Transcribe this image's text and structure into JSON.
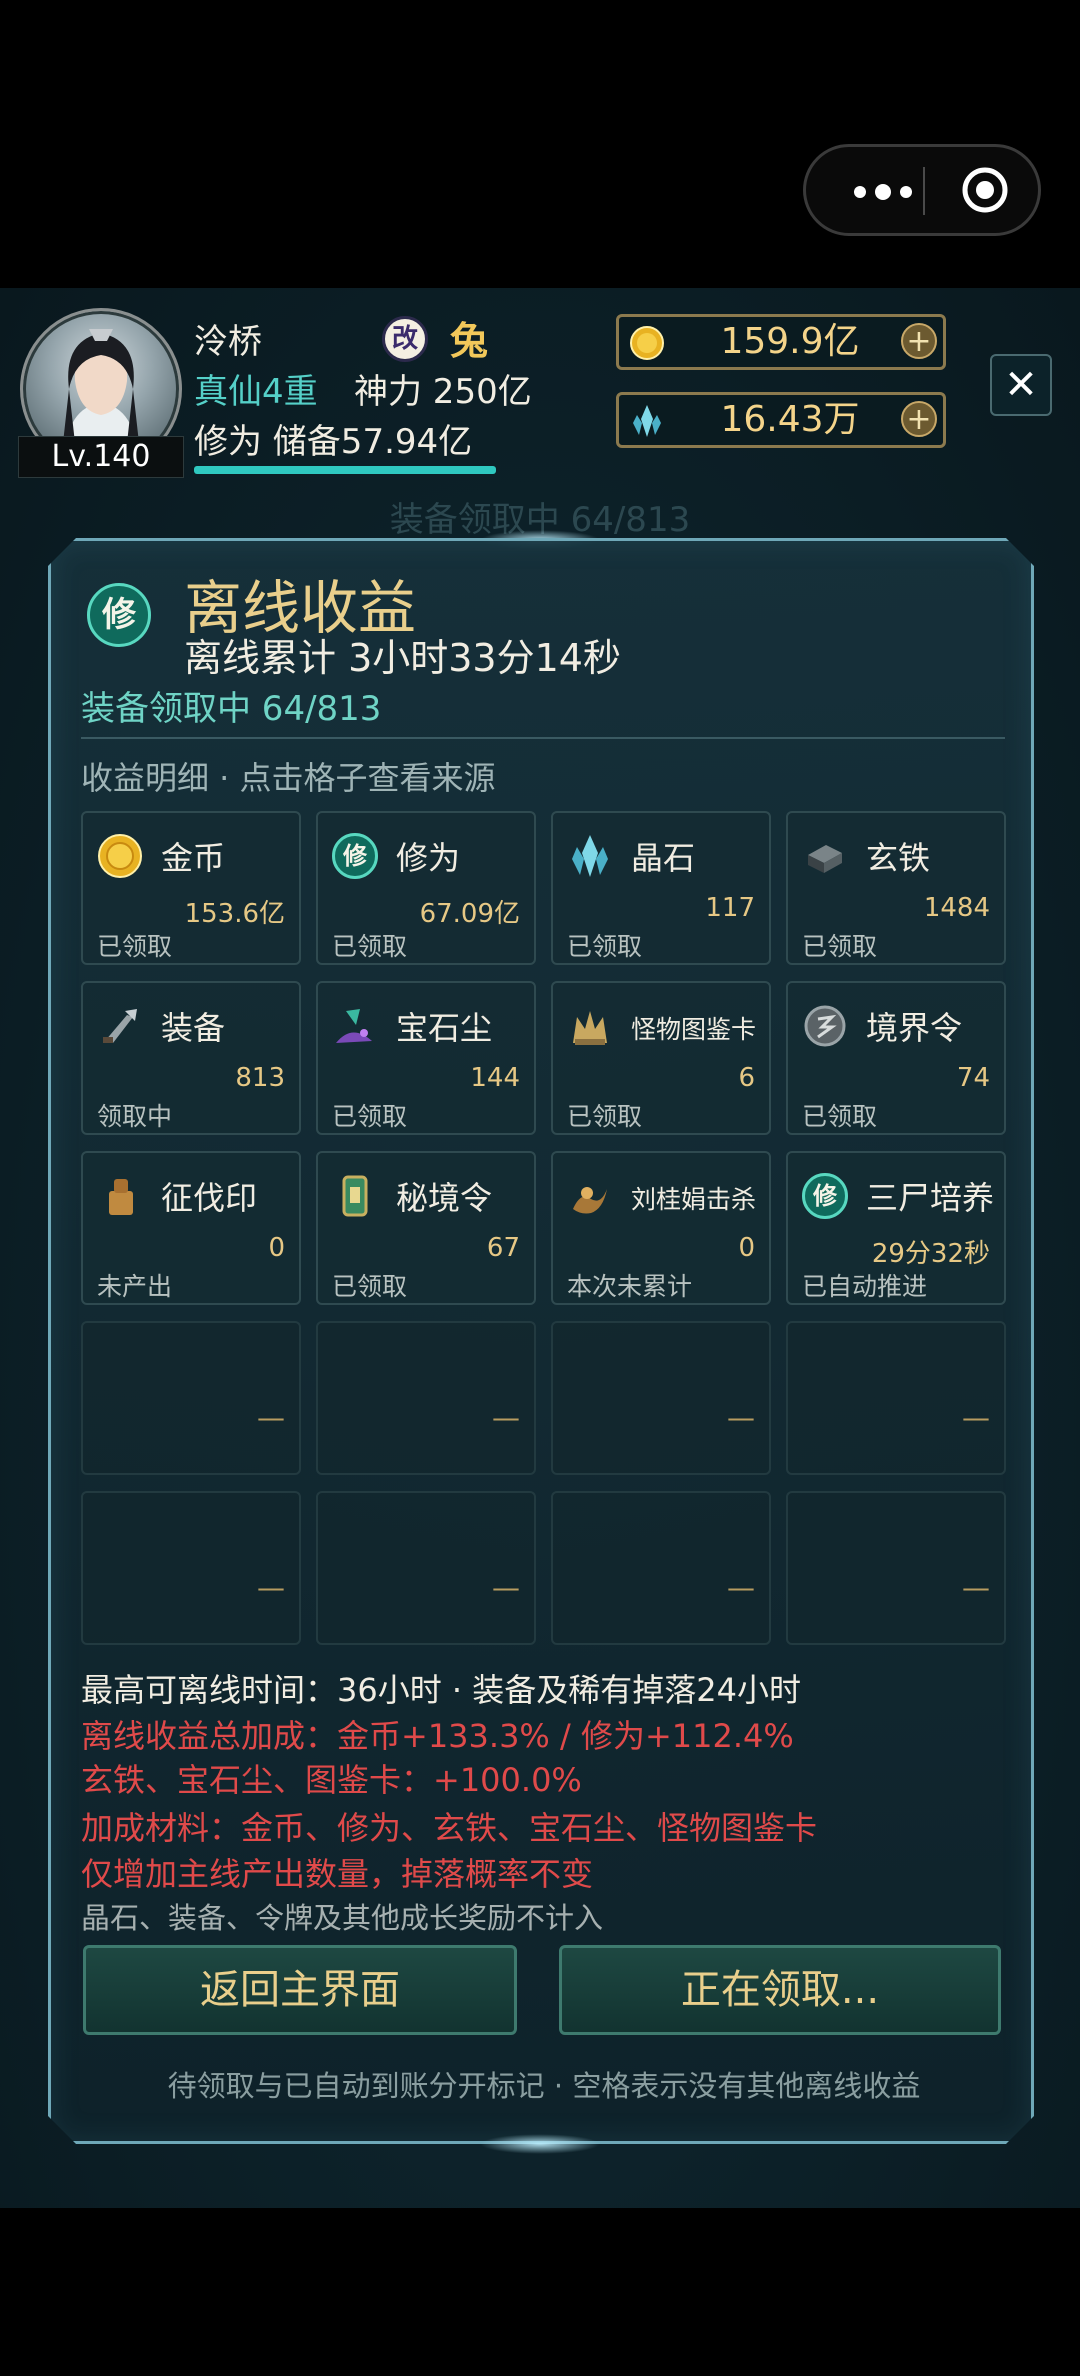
{
  "player": {
    "level": "Lv.140",
    "name": "泠桥",
    "badge": "改",
    "zodiac": "兔",
    "realm": "真仙4重",
    "power": "神力 250亿",
    "xiuwei": "修为 储备57.94亿"
  },
  "currencies": {
    "gold": "159.9亿",
    "crystal": "16.43万",
    "plus": "+"
  },
  "close_label": "✕",
  "ghost_status": "装备领取中 64/813",
  "panel": {
    "icon_char": "修",
    "title": "离线收益",
    "subtitle": "离线累计 3小时33分14秒",
    "equip_status": "装备领取中 64/813",
    "detail_label": "收益明细 · 点击格子查看来源"
  },
  "items": [
    {
      "name": "金币",
      "value": "153.6亿",
      "status": "已领取",
      "icon": "gold-coin-icon"
    },
    {
      "name": "修为",
      "value": "67.09亿",
      "status": "已领取",
      "icon": "xiuwei-icon"
    },
    {
      "name": "晶石",
      "value": "117",
      "status": "已领取",
      "icon": "crystal-icon"
    },
    {
      "name": "玄铁",
      "value": "1484",
      "status": "已领取",
      "icon": "iron-icon"
    },
    {
      "name": "装备",
      "value": "813",
      "status": "领取中",
      "icon": "equipment-icon"
    },
    {
      "name": "宝石尘",
      "value": "144",
      "status": "已领取",
      "icon": "gem-dust-icon"
    },
    {
      "name": "怪物图鉴卡",
      "value": "6",
      "status": "已领取",
      "icon": "monster-card-icon"
    },
    {
      "name": "境界令",
      "value": "74",
      "status": "已领取",
      "icon": "realm-token-icon"
    },
    {
      "name": "征伐印",
      "value": "0",
      "status": "未产出",
      "icon": "seal-icon"
    },
    {
      "name": "秘境令",
      "value": "67",
      "status": "已领取",
      "icon": "secret-token-icon"
    },
    {
      "name": "刘桂娟击杀",
      "value": "0",
      "status": "本次未累计",
      "icon": "kill-icon"
    },
    {
      "name": "三尸培养",
      "value": "29分32秒",
      "status": "已自动推进",
      "icon": "xiuwei-icon"
    }
  ],
  "empty_dash": "—",
  "info": {
    "max_time": "最高可离线时间：36小时 · 装备及稀有掉落24小时",
    "bonus_total": "离线收益总加成：金币+133.3% / 修为+112.4%",
    "bonus_materials": "玄铁、宝石尘、图鉴卡：+100.0%",
    "bonus_list": "加成材料：金币、修为、玄铁、宝石尘、怪物图鉴卡",
    "note_quantity": "仅增加主线产出数量，掉落概率不变",
    "note_excluded": "晶石、装备、令牌及其他成长奖励不计入"
  },
  "buttons": {
    "back": "返回主界面",
    "claiming": "正在领取..."
  },
  "footer": "待领取与已自动到账分开标记 · 空格表示没有其他离线收益",
  "colors": {
    "accent_gold": "#e9cf8c",
    "accent_teal": "#55d0c8",
    "warning_red": "#e04a4a"
  }
}
